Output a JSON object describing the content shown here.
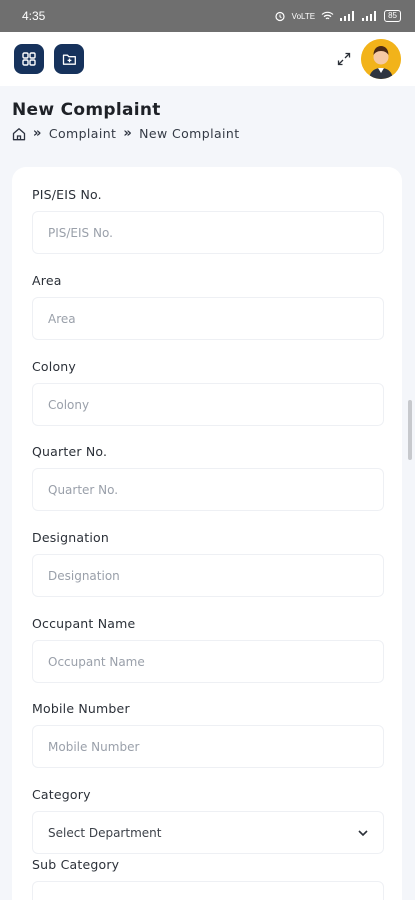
{
  "status_bar": {
    "time": "4:35",
    "battery": "85",
    "indicators": "VoLTE"
  },
  "app_bar": {
    "left_icons": [
      "grid-icon",
      "add-folder-icon"
    ],
    "right_icons": [
      "expand-icon",
      "avatar"
    ]
  },
  "page": {
    "title": "New Complaint",
    "breadcrumb": [
      "Complaint",
      "New Complaint"
    ]
  },
  "form": {
    "fields": [
      {
        "label": "PIS/EIS No.",
        "placeholder": "PIS/EIS No."
      },
      {
        "label": "Area",
        "placeholder": "Area"
      },
      {
        "label": "Colony",
        "placeholder": "Colony"
      },
      {
        "label": "Quarter No.",
        "placeholder": "Quarter No."
      },
      {
        "label": "Designation",
        "placeholder": "Designation"
      },
      {
        "label": "Occupant Name",
        "placeholder": "Occupant Name"
      },
      {
        "label": "Mobile Number",
        "placeholder": "Mobile Number"
      }
    ],
    "category": {
      "label": "Category",
      "selected": "Select Department"
    },
    "sub_category": {
      "label": "Sub Category"
    }
  },
  "colors": {
    "brand": "#16325c",
    "accent": "#f2b31a",
    "status_bar": "#6f6f6f"
  }
}
